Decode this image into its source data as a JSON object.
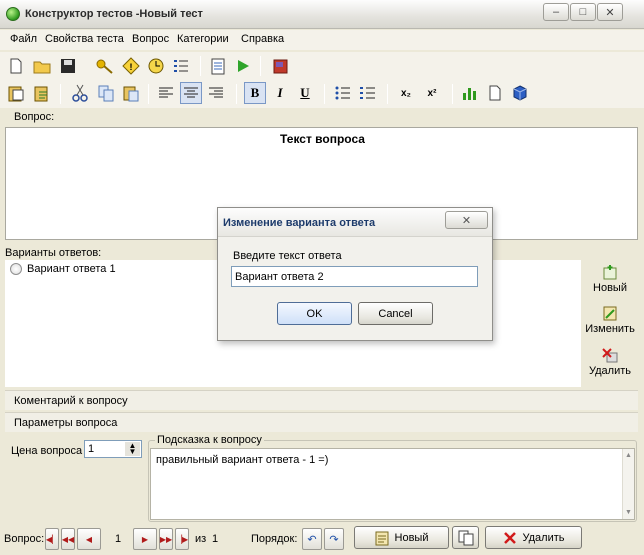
{
  "window": {
    "title": "Конструктор тестов -Новый тест",
    "minimize_glyph": "–",
    "maximize_glyph": "□",
    "close_glyph": "✕"
  },
  "menu": [
    "Файл",
    "Свойства теста",
    "Вопрос",
    "Категории",
    "Справка"
  ],
  "toolbar1": {
    "icons": [
      "new-file-icon",
      "open-folder-icon",
      "save-icon",
      "key-icon",
      "warning-icon",
      "clock-icon",
      "numbered-list-icon",
      "checklist-icon",
      "run-icon",
      "book-icon"
    ]
  },
  "toolbar2": {
    "icons": [
      "paste-special-icon",
      "paste-clipboard-icon",
      "cut-icon",
      "copy-icon",
      "paste-icon",
      "align-left-icon",
      "align-center-icon",
      "align-right-icon",
      "bold-icon",
      "italic-icon",
      "underline-icon",
      "bullet-list-icon",
      "numbered-list-icon",
      "subscript-icon",
      "superscript-icon",
      "chart-icon",
      "page-icon",
      "cube-icon"
    ],
    "bold": "B",
    "italic": "I",
    "underline": "U",
    "sub": "x₂",
    "sup": "x²"
  },
  "question": {
    "label": "Вопрос:",
    "text": "Текст вопроса"
  },
  "answers": {
    "label": "Варианты ответов:",
    "items": [
      "Вариант ответа 1"
    ],
    "new_label": "Новый",
    "edit_label": "Изменить",
    "delete_label": "Удалить"
  },
  "sections": {
    "comment": "Коментарий к вопросу",
    "params": "Параметры вопроса"
  },
  "params": {
    "price_label": "Цена вопроса",
    "price_value": "1",
    "hint_label": "Подсказка к вопросу",
    "hint_text": "правильный вариант ответа - 1 =)"
  },
  "nav": {
    "question_label": "Вопрос:",
    "current": "1",
    "of_label": "из",
    "total": "1",
    "order_label": "Порядок:",
    "new_label": "Новый",
    "delete_label": "Удалить"
  },
  "dialog": {
    "title": "Изменение варианта ответа",
    "prompt": "Введите текст ответа",
    "input_value": "Вариант ответа 2",
    "ok_label": "OK",
    "cancel_label": "Cancel",
    "close_glyph": "✕"
  },
  "colors": {
    "window_bg": "#ece9d8",
    "accent_blue": "#1d3b6b",
    "nav_arrow_red": "#b01b1b"
  }
}
